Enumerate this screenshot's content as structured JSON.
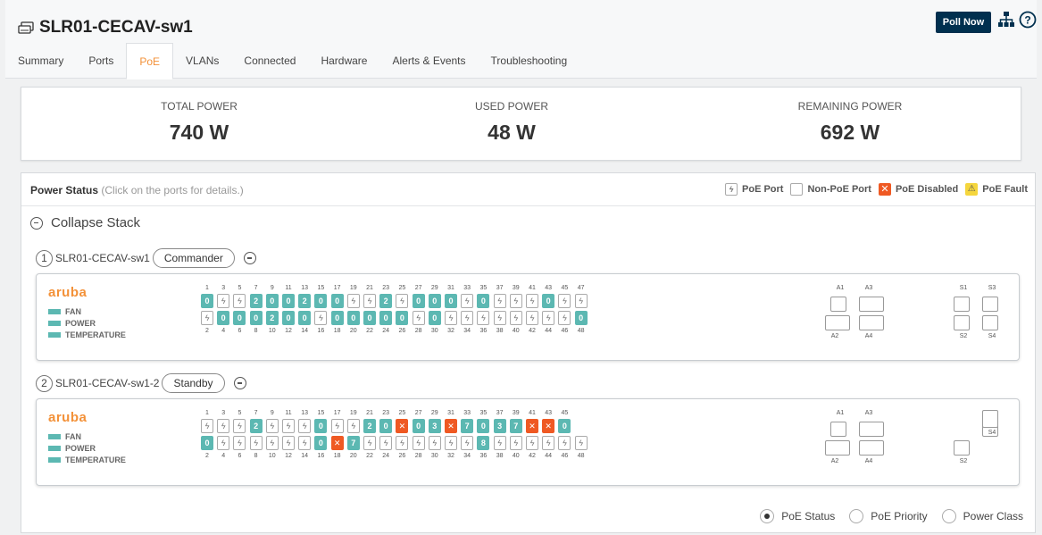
{
  "header": {
    "device_name": "SLR01-CECAV-sw1",
    "poll_button": "Poll Now",
    "tabs": [
      "Summary",
      "Ports",
      "PoE",
      "VLANs",
      "Connected",
      "Hardware",
      "Alerts & Events",
      "Troubleshooting"
    ],
    "active_tab": "PoE"
  },
  "power": {
    "total_label": "TOTAL POWER",
    "total_value": "740 W",
    "used_label": "USED POWER",
    "used_value": "48 W",
    "remaining_label": "REMAINING POWER",
    "remaining_value": "692 W"
  },
  "status": {
    "title": "Power Status",
    "hint": "(Click on the ports for details.)",
    "legend": {
      "poe_port": "PoE Port",
      "non_poe_port": "Non-PoE Port",
      "poe_disabled": "PoE Disabled",
      "poe_fault": "PoE Fault"
    },
    "collapse_label": "Collapse Stack"
  },
  "colors": {
    "accent": "#f39138",
    "navy": "#01304f",
    "teal": "#5cb8b2",
    "disabled": "#ef5923",
    "fault": "#f5d63d"
  },
  "sensor_labels": [
    "FAN",
    "POWER",
    "TEMPERATURE"
  ],
  "brand": "aruba",
  "members": [
    {
      "index": "1",
      "name": "SLR01-CECAV-sw1",
      "role": "Commander",
      "top": [
        "0",
        "p",
        "p",
        "2",
        "0",
        "0",
        "2",
        "0",
        "0",
        "p",
        "p",
        "2",
        "p",
        "0",
        "0",
        "0",
        "p",
        "0",
        "p",
        "p",
        "p",
        "0",
        "p",
        "p"
      ],
      "bottom": [
        "p",
        "0",
        "0",
        "0",
        "2",
        "0",
        "0",
        "p",
        "0",
        "0",
        "0",
        "0",
        "0",
        "p",
        "0",
        "p",
        "p",
        "p",
        "p",
        "p",
        "p",
        "p",
        "p",
        "0"
      ],
      "uplinks_top": [
        "A1",
        "A3",
        "S1",
        "S3"
      ],
      "uplinks_bottom": [
        "A2",
        "A4",
        "S2",
        "S4"
      ]
    },
    {
      "index": "2",
      "name": "SLR01-CECAV-sw1-2",
      "role": "Standby",
      "top": [
        "p",
        "p",
        "p",
        "2",
        "p",
        "p",
        "p",
        "0",
        "p",
        "p",
        "2",
        "0",
        "x",
        "0",
        "3",
        "x",
        "7",
        "0",
        "3",
        "7",
        "x",
        "x",
        "0"
      ],
      "bottom": [
        "0",
        "p",
        "p",
        "p",
        "p",
        "p",
        "p",
        "0",
        "x",
        "7",
        "p",
        "p",
        "p",
        "p",
        "p",
        "p",
        "p",
        "8",
        "p",
        "p",
        "p",
        "p",
        "p",
        "p"
      ],
      "uplinks_top": [
        "A1",
        "A3",
        "S3"
      ],
      "uplinks_bottom": [
        "A2",
        "A4",
        "S2",
        "S4"
      ]
    }
  ],
  "view_options": [
    "PoE Status",
    "PoE Priority",
    "Power Class"
  ],
  "selected_view": "PoE Status"
}
